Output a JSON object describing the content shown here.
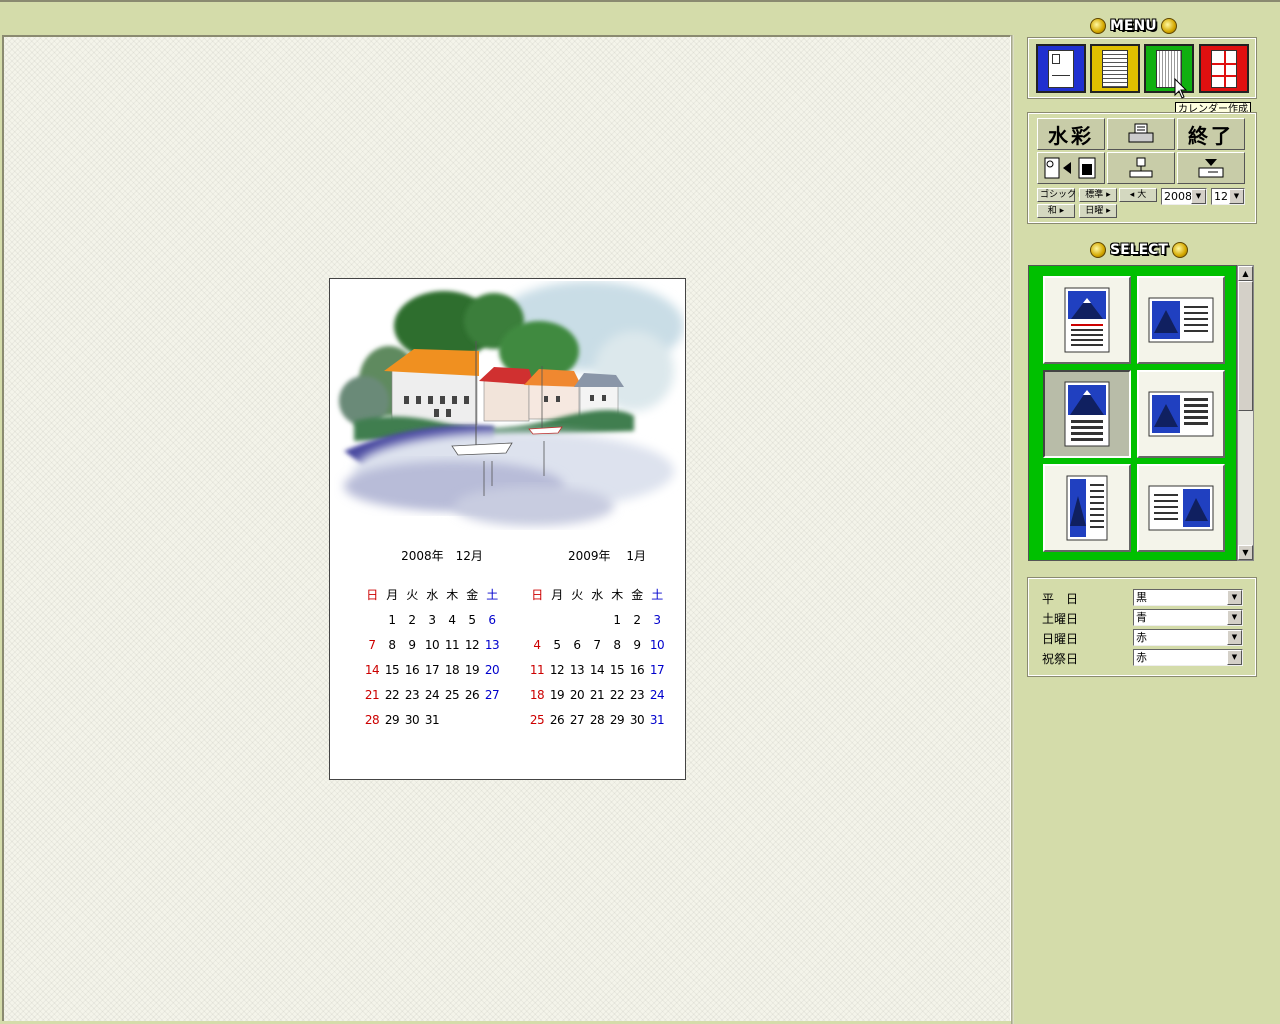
{
  "menu": {
    "title": "MENU",
    "buttons": [
      {
        "name": "menu-button-1",
        "color": "#2030d0"
      },
      {
        "name": "menu-button-2",
        "color": "#e0c000"
      },
      {
        "name": "menu-button-calendar",
        "color": "#10b010"
      },
      {
        "name": "menu-button-4",
        "color": "#e01010"
      }
    ],
    "tooltip": "カレンダー作成"
  },
  "tools": {
    "watercolor_label": "水彩",
    "quit_label": "終了",
    "font_label": "ゴシック",
    "weight_label": "標準",
    "size_label": "大",
    "era_label": "和",
    "weekday_label": "日曜",
    "year_value": "2008",
    "month_value": "12"
  },
  "select": {
    "title": "SELECT"
  },
  "colors": {
    "rows": [
      {
        "label": "平　日",
        "value": "黒"
      },
      {
        "label": "土曜日",
        "value": "青"
      },
      {
        "label": "日曜日",
        "value": "赤"
      },
      {
        "label": "祝祭日",
        "value": "赤"
      }
    ]
  },
  "calendar": {
    "weekday_headers": [
      "日",
      "月",
      "火",
      "水",
      "木",
      "金",
      "土"
    ],
    "months": [
      {
        "title": "2008年　12月",
        "days": [
          "",
          "1",
          "2",
          "3",
          "4",
          "5",
          "6",
          "7",
          "8",
          "9",
          "10",
          "11",
          "12",
          "13",
          "14",
          "15",
          "16",
          "17",
          "18",
          "19",
          "20",
          "21",
          "22",
          "23",
          "24",
          "25",
          "26",
          "27",
          "28",
          "29",
          "30",
          "31"
        ]
      },
      {
        "title": "2009年　 1月",
        "days": [
          "",
          "",
          "",
          "",
          "1",
          "2",
          "3",
          "4",
          "5",
          "6",
          "7",
          "8",
          "9",
          "10",
          "11",
          "12",
          "13",
          "14",
          "15",
          "16",
          "17",
          "18",
          "19",
          "20",
          "21",
          "22",
          "23",
          "24",
          "25",
          "26",
          "27",
          "28",
          "29",
          "30",
          "31"
        ]
      }
    ]
  }
}
